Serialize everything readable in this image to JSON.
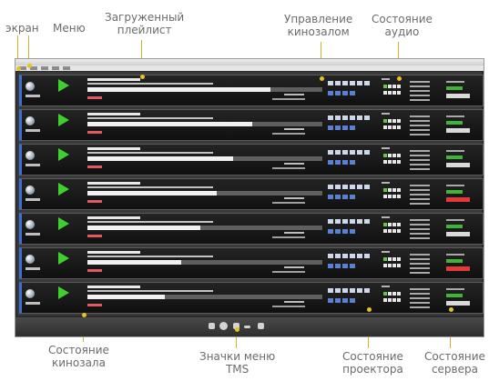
{
  "callouts": {
    "screen": "экран",
    "menu": "Меню",
    "playlist_line1": "Загруженный",
    "playlist_line2": "плейлист",
    "hall_control_line1": "Управление",
    "hall_control_line2": "кинозалом",
    "audio_state_line1": "Состояние",
    "audio_state_line2": "аудио",
    "hall_state_line1": "Состояние",
    "hall_state_line2": "кинозала",
    "tms_icons_line1": "Значки меню",
    "tms_icons_line2": "TMS",
    "projector_state_line1": "Состояние",
    "projector_state_line2": "проектора",
    "server_state_line1": "Состояние",
    "server_state_line2": "сервера"
  },
  "rows": [
    {
      "progress": 0.78,
      "server_color": "#d9d9d9"
    },
    {
      "progress": 0.7,
      "server_color": "#d9d9d9"
    },
    {
      "progress": 0.62,
      "server_color": "#d9d9d9"
    },
    {
      "progress": 0.55,
      "server_color": "#e03a3a"
    },
    {
      "progress": 0.48,
      "server_color": "#d9d9d9"
    },
    {
      "progress": 0.4,
      "server_color": "#e03a3a"
    },
    {
      "progress": 0.33,
      "server_color": "#d9d9d9"
    }
  ],
  "colors": {
    "accent_blue": "#3c6fd1",
    "play_green": "#3fcf2f",
    "status_green": "#3fb535",
    "status_red": "#e03a3a",
    "callout_line": "#d4b12a"
  }
}
